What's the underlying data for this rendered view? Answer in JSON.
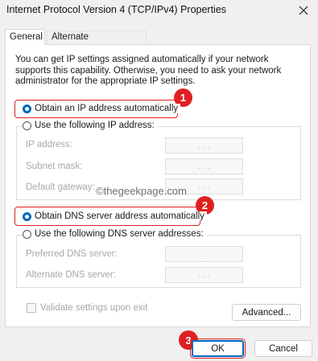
{
  "window": {
    "title": "Internet Protocol Version 4 (TCP/IPv4) Properties"
  },
  "tabs": [
    {
      "label": "General",
      "active": true
    },
    {
      "label": "Alternate Configuration",
      "active": false
    }
  ],
  "description": "You can get IP settings assigned automatically if your network supports this capability. Otherwise, you need to ask your network administrator for the appropriate IP settings.",
  "ip_section": {
    "auto_label": "Obtain an IP address automatically",
    "auto_selected": true,
    "manual_label": "Use the following IP address:",
    "fields": [
      {
        "label": "IP address:",
        "value": ".   .   ."
      },
      {
        "label": "Subnet mask:",
        "value": ".   .   ."
      },
      {
        "label": "Default gateway:",
        "value": ".   .   ."
      }
    ]
  },
  "dns_section": {
    "auto_label": "Obtain DNS server address automatically",
    "auto_selected": true,
    "manual_label": "Use the following DNS server addresses:",
    "fields": [
      {
        "label": "Preferred DNS server:",
        "value": ".   .   ."
      },
      {
        "label": "Alternate DNS server:",
        "value": ".   .   ."
      }
    ]
  },
  "validate_label": "Validate settings upon exit",
  "watermark": "©thegeekpage.com",
  "badges": [
    "1",
    "2",
    "3"
  ],
  "buttons": {
    "advanced": "Advanced...",
    "ok": "OK",
    "cancel": "Cancel"
  },
  "colors": {
    "accent": "#0067c0",
    "annotation": "#e02020"
  },
  "icons": {
    "close": "close-icon"
  }
}
